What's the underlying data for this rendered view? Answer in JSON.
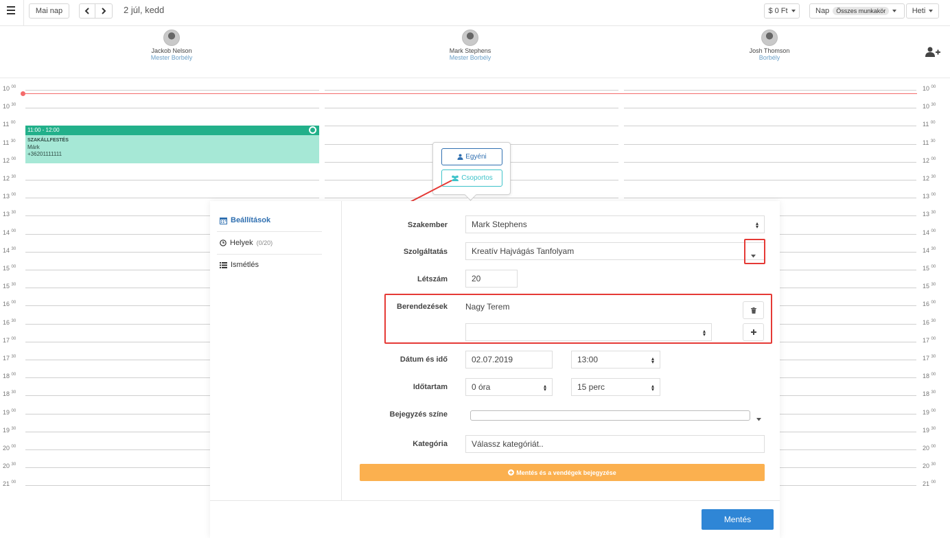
{
  "topbar": {
    "today_label": "Mai nap",
    "date_label": "2 júl, kedd",
    "money_label": "$ 0 Ft",
    "view_day_label": "Nap",
    "view_filter_chip": "Összes munkakör",
    "view_week_label": "Heti"
  },
  "staff": [
    {
      "name": "Jackob Nelson",
      "role": "Mester Borbély"
    },
    {
      "name": "Mark Stephens",
      "role": "Mester Borbély"
    },
    {
      "name": "Josh Thomson",
      "role": "Borbély"
    }
  ],
  "times": [
    {
      "h": "10",
      "m": "00"
    },
    {
      "h": "10",
      "m": "30"
    },
    {
      "h": "11",
      "m": "00"
    },
    {
      "h": "11",
      "m": "30"
    },
    {
      "h": "12",
      "m": "00"
    },
    {
      "h": "12",
      "m": "30"
    },
    {
      "h": "13",
      "m": "00"
    },
    {
      "h": "13",
      "m": "30"
    },
    {
      "h": "14",
      "m": "00"
    },
    {
      "h": "14",
      "m": "30"
    },
    {
      "h": "15",
      "m": "00"
    },
    {
      "h": "15",
      "m": "30"
    },
    {
      "h": "16",
      "m": "00"
    },
    {
      "h": "16",
      "m": "30"
    },
    {
      "h": "17",
      "m": "00"
    },
    {
      "h": "17",
      "m": "30"
    },
    {
      "h": "18",
      "m": "00"
    },
    {
      "h": "18",
      "m": "30"
    },
    {
      "h": "19",
      "m": "00"
    },
    {
      "h": "19",
      "m": "30"
    },
    {
      "h": "20",
      "m": "00"
    },
    {
      "h": "20",
      "m": "30"
    },
    {
      "h": "21",
      "m": "00"
    }
  ],
  "event": {
    "time": "11:00 - 12:00",
    "service": "SZAKÁLLFESTÉS",
    "client": "Márk",
    "phone": "+36201111111"
  },
  "popover": {
    "single_label": "Egyéni",
    "group_label": "Csoportos"
  },
  "modal": {
    "sidebar": {
      "settings_label": "Beállítások",
      "places_label": "Helyek",
      "places_count": "(0/20)",
      "repeat_label": "Ismétlés"
    },
    "form": {
      "specialist_label": "Szakember",
      "specialist_value": "Mark Stephens",
      "service_label": "Szolgáltatás",
      "service_value": "Kreatív Hajvágás Tanfolyam",
      "headcount_label": "Létszám",
      "headcount_value": "20",
      "equipment_label": "Berendezések",
      "equipment_value": "Nagy Terem",
      "datetime_label": "Dátum és idő",
      "date_value": "02.07.2019",
      "time_value": "13:00",
      "duration_label": "Időtartam",
      "duration_hours": "0 óra",
      "duration_minutes": "15 perc",
      "color_label": "Bejegyzés színe",
      "category_label": "Kategória",
      "category_placeholder": "Válassz kategóriát.."
    },
    "save_guests_label": "Mentés és a vendégek bejegyzése",
    "save_label": "Mentés"
  },
  "colors": {
    "accent": "#2f86d6",
    "event_header": "#22b08a",
    "event_body": "#a6e8d6",
    "now_line": "#f46b6b",
    "highlight": "#e53935",
    "warning_button": "#fbb04f"
  }
}
